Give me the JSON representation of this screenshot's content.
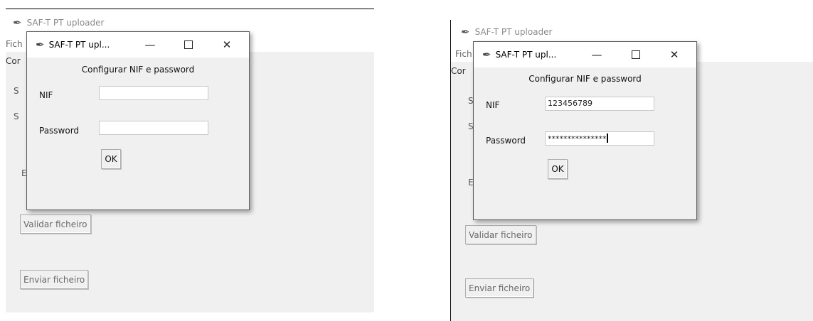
{
  "panels": [
    {
      "main": {
        "title": "SAF-T PT uploader",
        "menu_partial": "Fich",
        "frame_partial": "Cor",
        "hidden_letters": [
          "S",
          "S",
          "E"
        ],
        "validate_label": "Validar ficheiro",
        "send_label": "Enviar ficheiro"
      },
      "dialog": {
        "title": "SAF-T PT upl...",
        "heading": "Configurar NIF e password",
        "nif_label": "NIF",
        "nif_value": "",
        "password_label": "Password",
        "password_value": "",
        "ok_label": "OK"
      }
    },
    {
      "main": {
        "title": "SAF-T PT uploader",
        "menu_partial": "Fich",
        "frame_partial": "Cor",
        "hidden_letters": [
          "S",
          "S",
          "E"
        ],
        "validate_label": "Validar ficheiro",
        "send_label": "Enviar ficheiro"
      },
      "dialog": {
        "title": "SAF-T PT upl...",
        "heading": "Configurar NIF e password",
        "nif_label": "NIF",
        "nif_value": "123456789",
        "password_label": "Password",
        "password_value": "***************",
        "ok_label": "OK"
      }
    }
  ],
  "controls": {
    "minimize": "—",
    "close": "✕"
  },
  "icons": {
    "app": "feather-icon",
    "feather_glyph": "✒"
  }
}
